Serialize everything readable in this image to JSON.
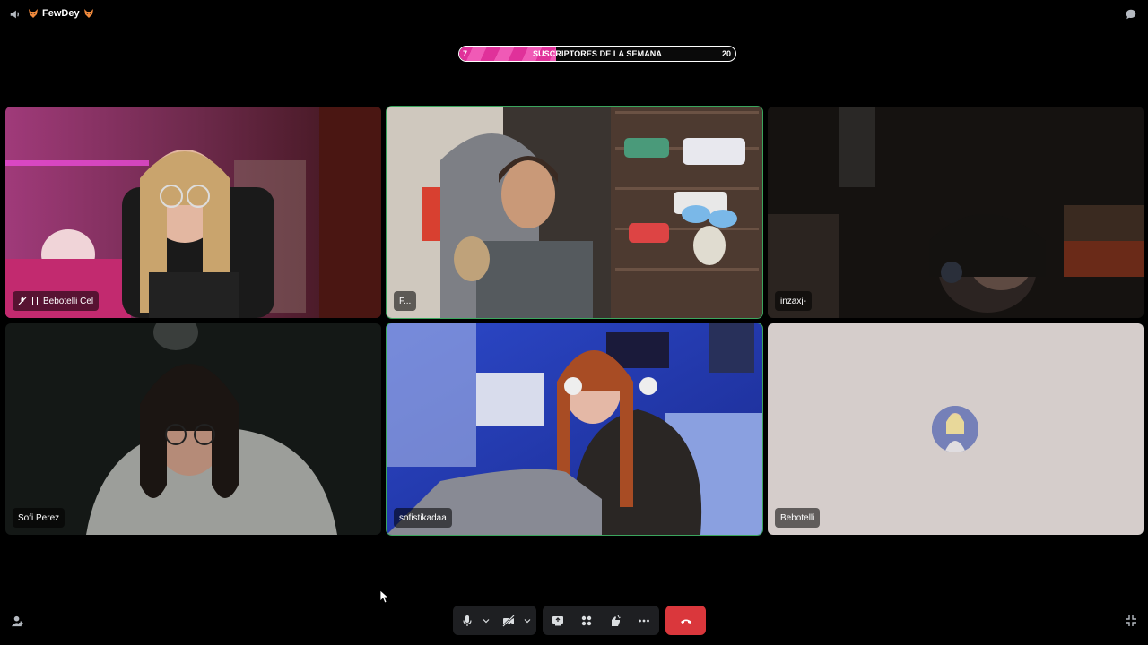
{
  "channel": {
    "name": "FewDey",
    "prefix_icon": "fox-emoji",
    "suffix_icon": "fox-emoji"
  },
  "goal": {
    "title": "SUSCRIPTORES DE LA SEMANA",
    "current": "7",
    "target": "20",
    "progress": 0.35
  },
  "participants": [
    {
      "name": "Bebotelli Cel",
      "icons": [
        "mic-muted-icon",
        "phone-icon"
      ],
      "video": true
    },
    {
      "name": "F...",
      "video": true,
      "speaking": true
    },
    {
      "name": "inzaxj-",
      "video": true
    },
    {
      "name": "Sofi Perez",
      "video": true
    },
    {
      "name": "sofistikadaa",
      "video": true,
      "speaking": true
    },
    {
      "name": "Bebotelli",
      "video": false
    }
  ],
  "colors": {
    "speaking_outline": "#3ba55d",
    "hangup": "#da373c",
    "goal_fill": "#e0319a",
    "control_bg": "#1e1f22",
    "empty_tile_bg": "#d5cdcb"
  }
}
